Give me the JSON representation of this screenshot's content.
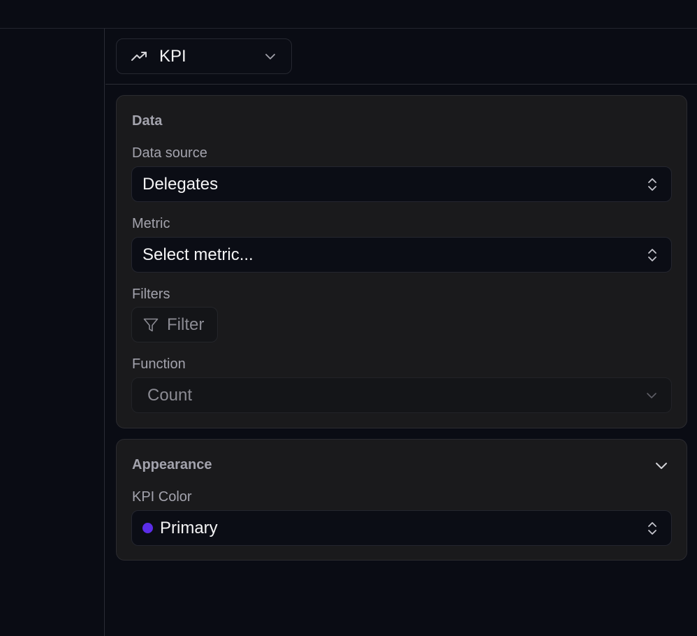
{
  "toolbar": {
    "chart_type": {
      "label": "KPI",
      "icon": "trending-up-icon"
    }
  },
  "data_section": {
    "title": "Data",
    "data_source": {
      "label": "Data source",
      "value": "Delegates"
    },
    "metric": {
      "label": "Metric",
      "value": "Select metric..."
    },
    "filters": {
      "label": "Filters",
      "button_label": "Filter"
    },
    "function": {
      "label": "Function",
      "value": "Count"
    }
  },
  "appearance_section": {
    "title": "Appearance",
    "kpi_color": {
      "label": "KPI Color",
      "value": "Primary",
      "swatch": "#5b2de8"
    }
  }
}
